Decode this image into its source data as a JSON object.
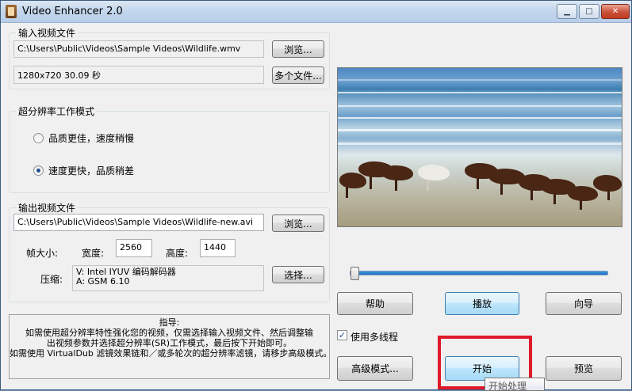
{
  "window": {
    "title": "Video Enhancer 2.0",
    "minimize_icon": "minimize-icon",
    "maximize_icon": "maximize-icon",
    "close_icon": "close-icon"
  },
  "input": {
    "group_title": "输入视频文件",
    "path": "C:\\Users\\Public\\Videos\\Sample Videos\\Wildlife.wmv",
    "info": "1280x720 30.09 秒",
    "browse_label": "浏览...",
    "multi_label": "多个文件..."
  },
  "mode": {
    "group_title": "超分辨率工作模式",
    "options": [
      {
        "label": "品质更佳，速度稍慢",
        "selected": false
      },
      {
        "label": "速度更快，品质稍差",
        "selected": true
      }
    ]
  },
  "output": {
    "group_title": "输出视频文件",
    "path": "C:\\Users\\Public\\Videos\\Sample Videos\\Wildlife-new.avi",
    "browse_label": "浏览...",
    "frame_size_label": "帧大小:",
    "width_label": "宽度:",
    "width_value": "2560",
    "height_label": "高度:",
    "height_value": "1440",
    "compression_label": "压缩:",
    "compression_video": "V: Intel IYUV 编码解码器",
    "compression_audio": "A: GSM 6.10",
    "choose_label": "选择..."
  },
  "help": {
    "title": "指导:",
    "lines": [
      "如需使用超分辨率特性强化您的视频，仅需选择输入视频文件、然后调整输",
      "出视频参数并选择超分辨率(SR)工作模式，最后按下开始即可。",
      "如需使用 VirtualDub 滤镜效果链和／或多轮次的超分辨率滤镜，请移步高级模式。"
    ]
  },
  "player": {
    "slider_position": 0.02
  },
  "buttons": {
    "help": "帮助",
    "play": "播放",
    "wizard": "向导",
    "advanced": "高级模式...",
    "start": "开始",
    "preview": "预览"
  },
  "multithread": {
    "label": "使用多线程",
    "checked": true,
    "check_glyph": "✓"
  },
  "tooltip": "开始处理",
  "colors": {
    "highlight": "#e0192a",
    "slider": "#1f6fc0"
  }
}
